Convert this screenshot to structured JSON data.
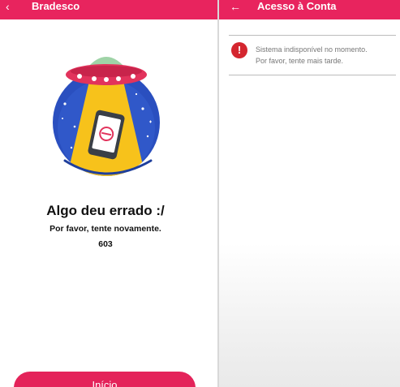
{
  "left_screen": {
    "header": {
      "back_icon": "‹",
      "title": "Bradesco"
    },
    "error": {
      "title": "Algo deu errado :/",
      "subtitle": "Por favor, tente novamente.",
      "code": "603"
    },
    "home_button": "Início"
  },
  "right_screen": {
    "header": {
      "back_icon": "←",
      "title": "Acesso à Conta"
    },
    "alert": {
      "icon": "!",
      "line1": "Sistema indisponível no momento.",
      "line2": "Por favor, tente mais tarde."
    }
  },
  "colors": {
    "brand": "#e8245e",
    "alert_red": "#d4262f"
  },
  "icons": {
    "illustration": "ufo-phone-illustration-icon",
    "alert": "alert-exclamation-icon"
  }
}
